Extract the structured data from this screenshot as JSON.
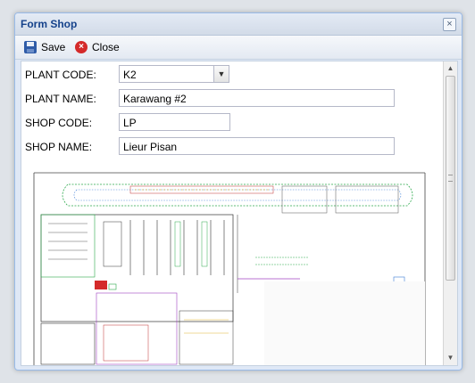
{
  "window": {
    "title": "Form Shop",
    "close_icon": "close-icon"
  },
  "toolbar": {
    "save": {
      "label": "Save",
      "icon": "floppy-disk-icon"
    },
    "close": {
      "label": "Close",
      "icon": "close-circle-icon"
    }
  },
  "form": {
    "plant_code": {
      "label": "PLANT CODE:",
      "value": "K2"
    },
    "plant_name": {
      "label": "PLANT NAME:",
      "value": "Karawang #2"
    },
    "shop_code": {
      "label": "SHOP CODE:",
      "value": "LP"
    },
    "shop_name": {
      "label": "SHOP NAME:",
      "value": "Lieur Pisan"
    }
  },
  "colors": {
    "window_title": "#15428b",
    "window_border": "#99bbe8",
    "close_icon": "#d42a2a"
  }
}
